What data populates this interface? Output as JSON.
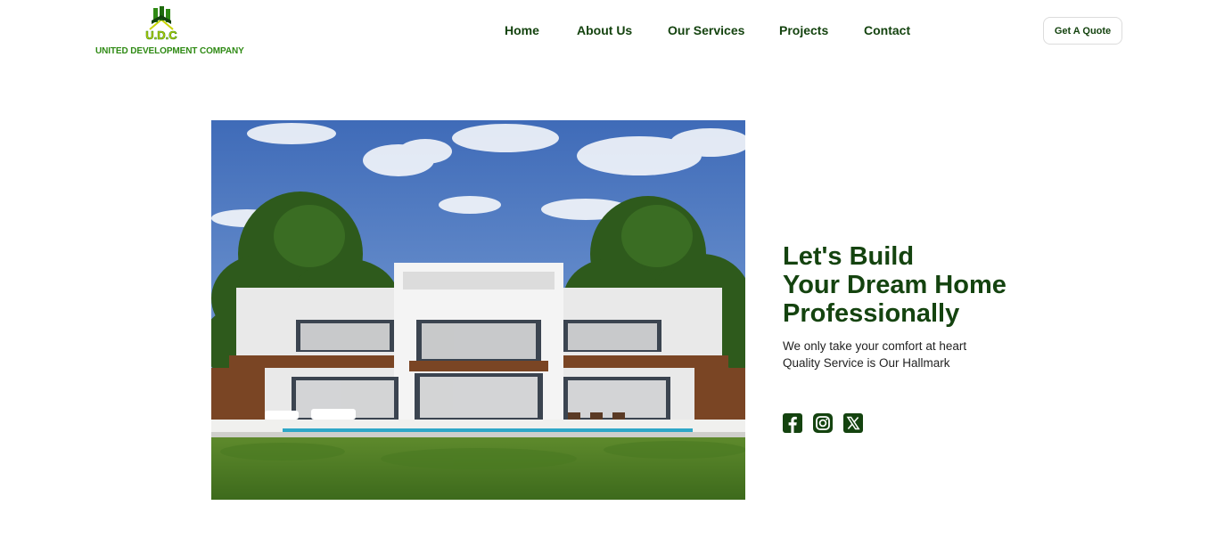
{
  "brand": {
    "logo_initials": "U.D.C",
    "company_name": "UNITED DEVELOPMENT COMPANY",
    "primary_color": "#14430f",
    "logo_green": "#2f8a14",
    "logo_yellow": "#c9d400"
  },
  "nav": {
    "items": [
      {
        "label": "Home"
      },
      {
        "label": "About Us"
      },
      {
        "label": "Our Services"
      },
      {
        "label": "Projects"
      },
      {
        "label": "Contact"
      }
    ],
    "cta_label": "Get A Quote"
  },
  "hero": {
    "image_icon": "modern-house-photo",
    "title_lines": [
      "Let's Build",
      "Your Dream Home",
      "Professionally"
    ],
    "subtitle_lines": [
      "We only take your comfort at heart",
      "Quality Service is Our Hallmark"
    ]
  },
  "socials": [
    {
      "icon": "facebook-icon"
    },
    {
      "icon": "instagram-icon"
    },
    {
      "icon": "x-twitter-icon"
    }
  ]
}
